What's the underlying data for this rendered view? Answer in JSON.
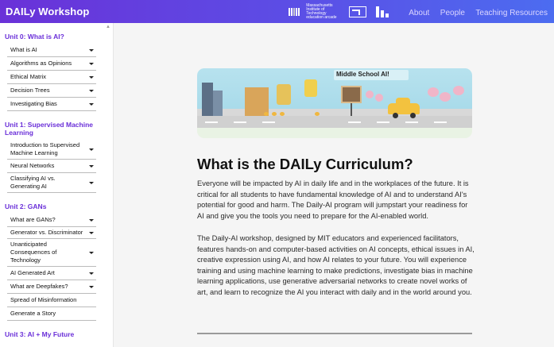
{
  "header": {
    "brand": "DAILy Workshop",
    "mit_logo_text": "Massachusetts Institute of Technology education arcade",
    "nav": [
      "About",
      "People",
      "Teaching Resources"
    ]
  },
  "sidebar": {
    "units": [
      {
        "title": "Unit 0: What is AI?",
        "items": [
          {
            "label": "What is AI",
            "expandable": true
          },
          {
            "label": "Algorithms as Opinions",
            "expandable": true
          },
          {
            "label": "Ethical Matrix",
            "expandable": true
          },
          {
            "label": "Decision Trees",
            "expandable": true
          },
          {
            "label": "Investigating Bias",
            "expandable": true
          }
        ]
      },
      {
        "title": "Unit 1: Supervised Machine Learning",
        "items": [
          {
            "label": "Introduction to Supervised Machine Learning",
            "expandable": true
          },
          {
            "label": "Neural Networks",
            "expandable": true
          },
          {
            "label": "Classifying AI vs. Generating AI",
            "expandable": true
          }
        ]
      },
      {
        "title": "Unit 2: GANs",
        "items": [
          {
            "label": "What are GANs?",
            "expandable": true
          },
          {
            "label": "Generator vs. Discriminator",
            "expandable": true
          },
          {
            "label": "Unanticipated Consequences of Technology",
            "expandable": true
          },
          {
            "label": "AI Generated Art",
            "expandable": true
          },
          {
            "label": "What are Deepfakes?",
            "expandable": true
          },
          {
            "label": "Spread of Misinformation",
            "expandable": false
          },
          {
            "label": "Generate a Story",
            "expandable": false
          }
        ]
      },
      {
        "title": "Unit 3: AI + My Future",
        "items": []
      }
    ]
  },
  "main": {
    "banner_title": "Middle School AI!",
    "heading": "What is the DAILy Curriculum?",
    "paragraph1": "Everyone will be impacted by AI in daily life and in the workplaces of the future. It is critical for all students to have fundamental knowledge of AI and to understand AI's potential for good and harm. The Daily-AI program will jumpstart your readiness for AI and give you the tools you need to prepare for the AI-enabled world.",
    "paragraph2": "The Daily-AI workshop, designed by MIT educators and experienced facilitators, features hands-on and computer-based activities on AI concepts, ethical issues in AI, creative expression using AI, and how AI relates to your future. You will experience training and using machine learning to make predictions, investigate bias in machine learning applications, use generative adversarial networks to create novel works of art, and learn to recognize the AI you interact with daily and in the world around you."
  },
  "colors": {
    "header_gradient_start": "#6a31d8",
    "header_gradient_end": "#4c6cf0",
    "unit_title": "#6a2fd8",
    "nav_link": "#dcd6ff"
  }
}
